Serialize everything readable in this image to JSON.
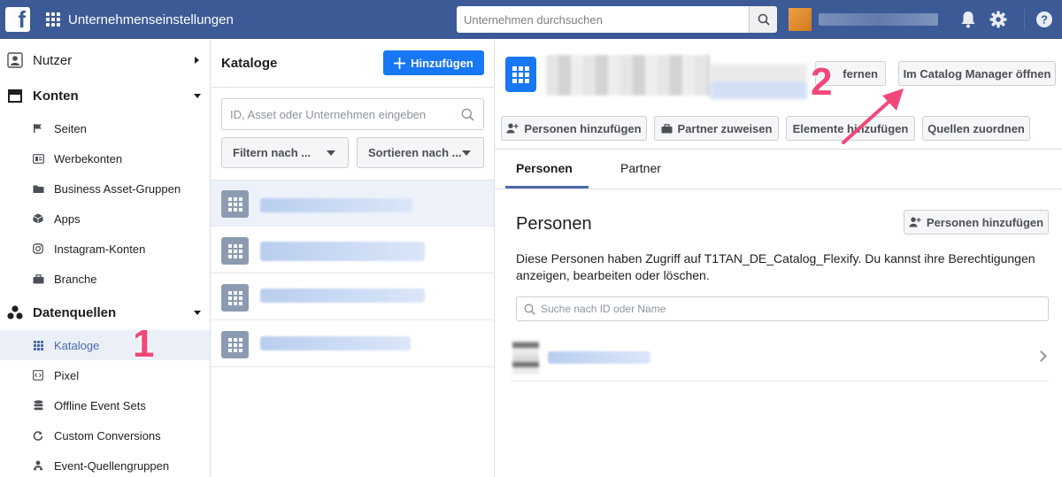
{
  "topbar": {
    "title": "Unternehmenseinstellungen",
    "search_placeholder": "Unternehmen durchsuchen"
  },
  "sidebar": {
    "users": "Nutzer",
    "accounts": "Konten",
    "account_items": [
      "Seiten",
      "Werbekonten",
      "Business Asset-Gruppen",
      "Apps",
      "Instagram-Konten",
      "Branche"
    ],
    "datasources": "Datenquellen",
    "datasource_items": [
      "Kataloge",
      "Pixel",
      "Offline Event Sets",
      "Custom Conversions",
      "Event-Quellengruppen"
    ]
  },
  "catalogs": {
    "header": "Kataloge",
    "add_button": "Hinzufügen",
    "search_placeholder": "ID, Asset oder Unternehmen eingeben",
    "filter_label": "Filtern nach ...",
    "sort_label": "Sortieren nach ..."
  },
  "detail": {
    "remove_button": "fernen",
    "open_manager_button": "Im Catalog Manager öffnen",
    "actions": [
      "Personen hinzufügen",
      "Partner zuweisen",
      "Elemente hinzufügen",
      "Quellen zuordnen"
    ],
    "tabs": [
      "Personen",
      "Partner"
    ],
    "section_title": "Personen",
    "section_add_button": "Personen hinzufügen",
    "section_desc": "Diese Personen haben Zugriff auf T1TAN_DE_Catalog_Flexify. Du kannst ihre Berechtigungen anzeigen, bearbeiten oder löschen.",
    "search_placeholder": "Suche nach ID oder Name"
  },
  "annotations": {
    "one": "1",
    "two": "2",
    "color": "#f0487a"
  },
  "colors": {
    "topbar": "#3b5a96",
    "primary": "#1877f2",
    "active_link": "#4a69a8"
  }
}
